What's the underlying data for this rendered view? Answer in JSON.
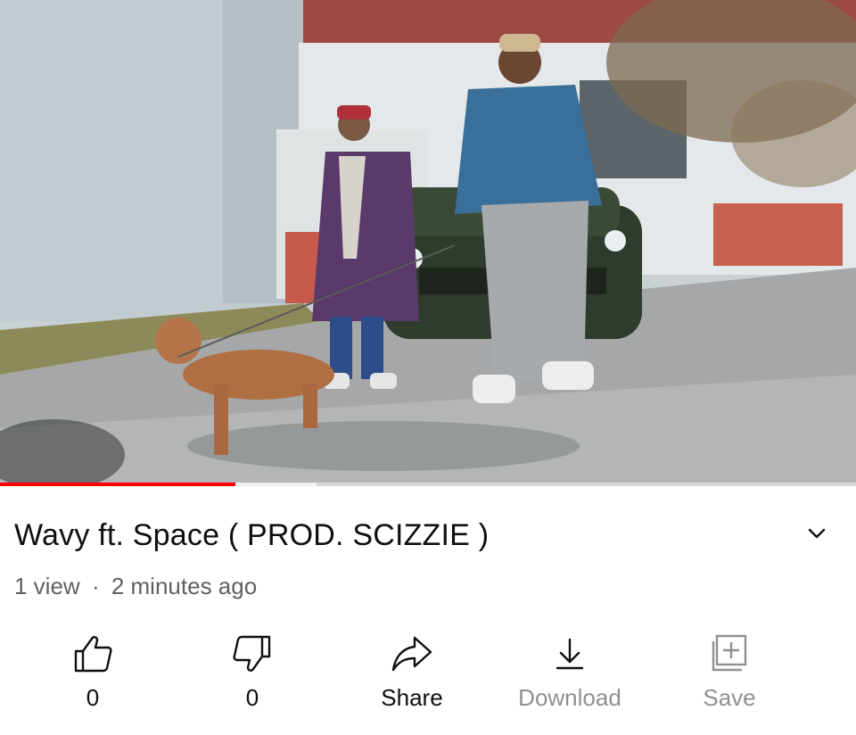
{
  "video": {
    "progress_played": 0.275,
    "progress_buffered": 0.37
  },
  "info": {
    "title": "Wavy ft. Space ( PROD. SCIZZIE )",
    "views": "1 view",
    "separator": "·",
    "uploaded": "2 minutes ago"
  },
  "actions": {
    "like_count": "0",
    "dislike_count": "0",
    "share_label": "Share",
    "download_label": "Download",
    "save_label": "Save"
  },
  "colors": {
    "progress": "#ff0000",
    "text_primary": "#0f0f0f",
    "text_secondary": "#606060",
    "text_disabled": "#909090"
  },
  "icons": [
    "chevron-down-icon",
    "thumbs-up-icon",
    "thumbs-down-icon",
    "share-arrow-icon",
    "download-icon",
    "save-playlist-icon"
  ]
}
